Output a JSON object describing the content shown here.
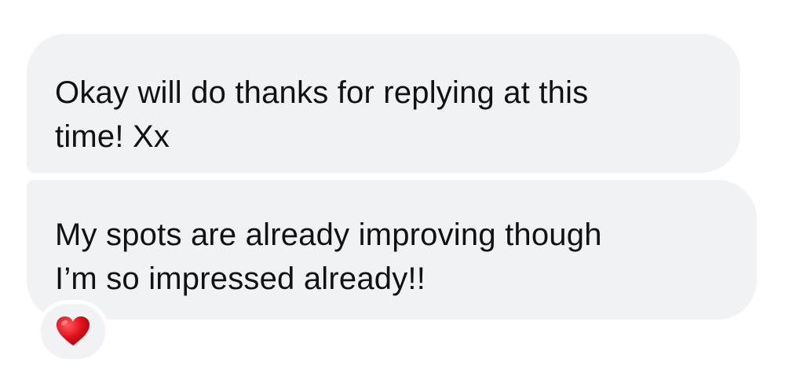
{
  "messages": [
    {
      "lines": [
        "Okay will do thanks for replying at this",
        "time! Xx"
      ]
    },
    {
      "lines": [
        "My spots are already improving though",
        "I’m so impressed already!!"
      ],
      "reaction": {
        "icon": "red-heart-icon",
        "color": "#e0111a"
      }
    }
  ],
  "colors": {
    "bubble": "#f1f2f4",
    "text": "#111111",
    "background": "#ffffff"
  }
}
